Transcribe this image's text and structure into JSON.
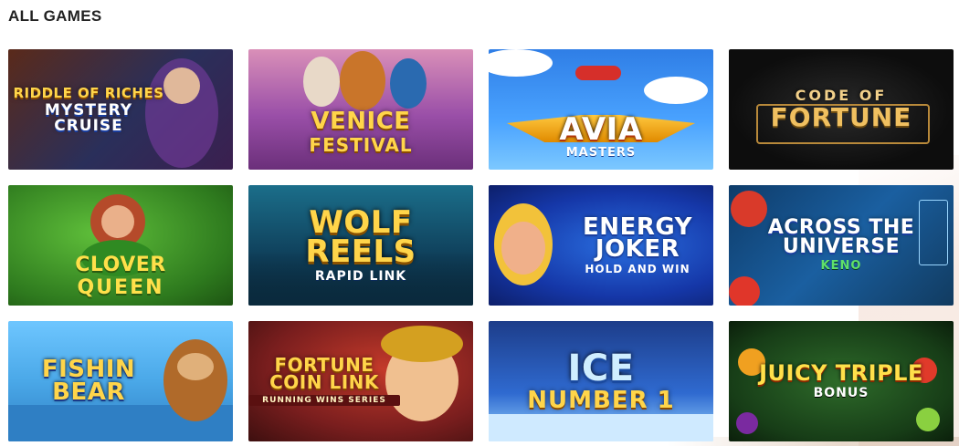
{
  "section": {
    "title": "ALL GAMES"
  },
  "games": [
    {
      "title": "RIDDLE OF RICHES",
      "subtitle": "MYSTERY CRUISE"
    },
    {
      "title": "VENICE",
      "subtitle": "FESTIVAL"
    },
    {
      "title": "AVIA",
      "subtitle": "MASTERS"
    },
    {
      "title": "CODE OF",
      "subtitle": "FORTUNE"
    },
    {
      "title": "CLOVER",
      "subtitle": "QUEEN"
    },
    {
      "title": "WOLF REELS",
      "subtitle": "RAPID LINK"
    },
    {
      "title": "ENERGY JOKER",
      "subtitle": "HOLD AND WIN"
    },
    {
      "title": "ACROSS THE UNIVERSE",
      "subtitle": "KENO"
    },
    {
      "title": "FISHIN BEAR",
      "subtitle": ""
    },
    {
      "title": "FORTUNE COIN LINK",
      "subtitle": "RUNNING WINS SERIES"
    },
    {
      "title": "ICE",
      "subtitle": "NUMBER 1"
    },
    {
      "title": "JUICY TRIPLE",
      "subtitle": "BONUS"
    }
  ]
}
